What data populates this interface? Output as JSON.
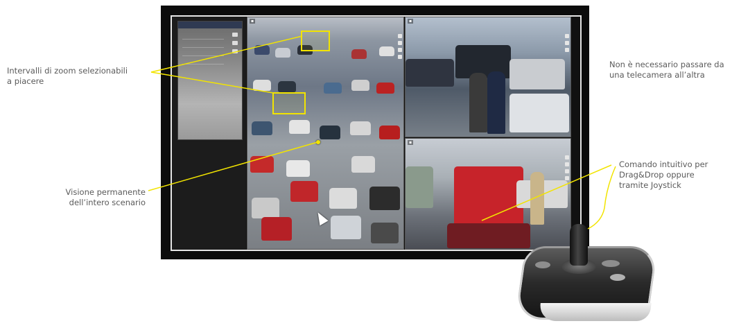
{
  "annotations": {
    "zoom": [
      "Intervalli di zoom selezionabili",
      "a piacere"
    ],
    "vision": [
      "Visione permanente",
      "dell’intero scenario"
    ],
    "no_camera_switch": [
      "Non è necessario passare da",
      "una telecamera all’altra"
    ],
    "command": [
      "Comando intuitivo per",
      "Drag&Drop oppure",
      "tramite Joystick"
    ]
  },
  "colors": {
    "callout_line": "#f2e400",
    "monitor_bezel": "#0c0c0c",
    "screen_border": "#e6e6e6",
    "label_text": "#5a5a5a"
  },
  "icons": [
    "mouse-pointer-icon",
    "joystick-device"
  ]
}
